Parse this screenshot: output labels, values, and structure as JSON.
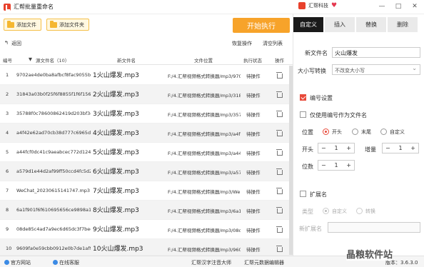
{
  "window": {
    "title": "汇帮批量重命名",
    "brand": "汇帮科技",
    "controls": [
      "—",
      "□",
      "✕"
    ]
  },
  "toolbar": {
    "add_file": "添加文件",
    "add_folder": "添加文件夹",
    "start": "开始执行"
  },
  "subbar": {
    "back": "返回",
    "restore": "恢复操作",
    "clear": "清空列表"
  },
  "table": {
    "headers": {
      "no": "编号",
      "orig": "源文件名（10）",
      "new": "新文件名",
      "path": "文件位置",
      "status": "执行状态",
      "action": "操作"
    },
    "rows": [
      {
        "no": "1",
        "orig": "9702ae4de0ba8afbcf8fac9055bai",
        "new": "1火山爆发.mp3",
        "path": "F:/4.汇帮视频格式转换器/mp3/970",
        "status": "待操作"
      },
      {
        "no": "2",
        "orig": "31843a03b0f25f6f8855f1f6f156",
        "new": "2火山爆发.mp3",
        "path": "F:/4.汇帮视频格式转换器/mp3/318",
        "status": "待操作"
      },
      {
        "no": "3",
        "orig": "35788f0c78600862419d203bf3e5",
        "new": "3火山爆发.mp3",
        "path": "F:/4.汇帮视频格式转换器/mp3/357",
        "status": "待操作"
      },
      {
        "no": "4",
        "orig": "a4f42e62ad70cb38d777c6965d3",
        "new": "4火山爆发.mp3",
        "path": "F:/4.汇帮视频格式转换器/mp3/a4f",
        "status": "待操作"
      },
      {
        "no": "5",
        "orig": "a44fcf0dc41c9aeabcec772d1240(",
        "new": "5火山爆发.mp3",
        "path": "F:/4.汇帮视频格式转换器/mp3/a44",
        "status": "待操作"
      },
      {
        "no": "6",
        "orig": "a579d1e44d2af99ff50ccd4fc5d2",
        "new": "6火山爆发.mp3",
        "path": "F:/4.汇帮视频格式转换器/mp3/a57",
        "status": "待操作"
      },
      {
        "no": "7",
        "orig": "WeChat_20230615141747.mp3",
        "new": "7火山爆发.mp3",
        "path": "F:/4.汇帮视频格式转换器/mp3/We",
        "status": "待操作"
      },
      {
        "no": "8",
        "orig": "6a1f901f6f610695656ce9898a13",
        "new": "8火山爆发.mp3",
        "path": "F:/4.汇帮视频格式转换器/mp3/6a1",
        "status": "待操作"
      },
      {
        "no": "9",
        "orig": "08de85c4ad7a9ec6d65dc3f7bed",
        "new": "9火山爆发.mp3",
        "path": "F:/4.汇帮视频格式转换器/mp3/08d",
        "status": "待操作"
      },
      {
        "no": "10",
        "orig": "9609fa0e59cbb0912e0b7de1af9€",
        "new": "10火山爆发.mp3",
        "path": "F:/4.汇帮视频格式转换器/mp3/960",
        "status": "待操作"
      }
    ]
  },
  "panel": {
    "tabs": [
      "自定义",
      "插入",
      "替换",
      "删除"
    ],
    "active_tab": "自定义",
    "new_name_label": "新文件名",
    "new_name_value": "火山爆发",
    "case_label": "大小写转换",
    "case_value": "不改变大小写",
    "numbering_label": "编号设置",
    "numbering_checked": true,
    "only_number_label": "仅使用编号作为文件名",
    "only_number_checked": false,
    "position_label": "位置",
    "position_options": [
      "开头",
      "末尾",
      "自定义"
    ],
    "position_selected": "开头",
    "start_label": "开头",
    "start_value": "1",
    "increment_label": "增量",
    "increment_value": "1",
    "digits_label": "位数",
    "digits_value": "1",
    "extension_label": "扩展名",
    "extension_checked": false,
    "type_label": "类型",
    "type_options": [
      "自定义",
      "转换"
    ],
    "type_selected": "自定义",
    "new_ext_label": "新扩展名"
  },
  "footer": {
    "website": "官方网站",
    "service": "在线客服",
    "link1": "汇帮汉字注音大师",
    "link2": "汇帮元数据编辑器",
    "version": "版本：3.6.3.0"
  },
  "watermark": "晶粮软件站",
  "colors": {
    "accent": "#e84a3a",
    "start_button": "#f7a32a",
    "active_tab": "#1a1a1a"
  }
}
